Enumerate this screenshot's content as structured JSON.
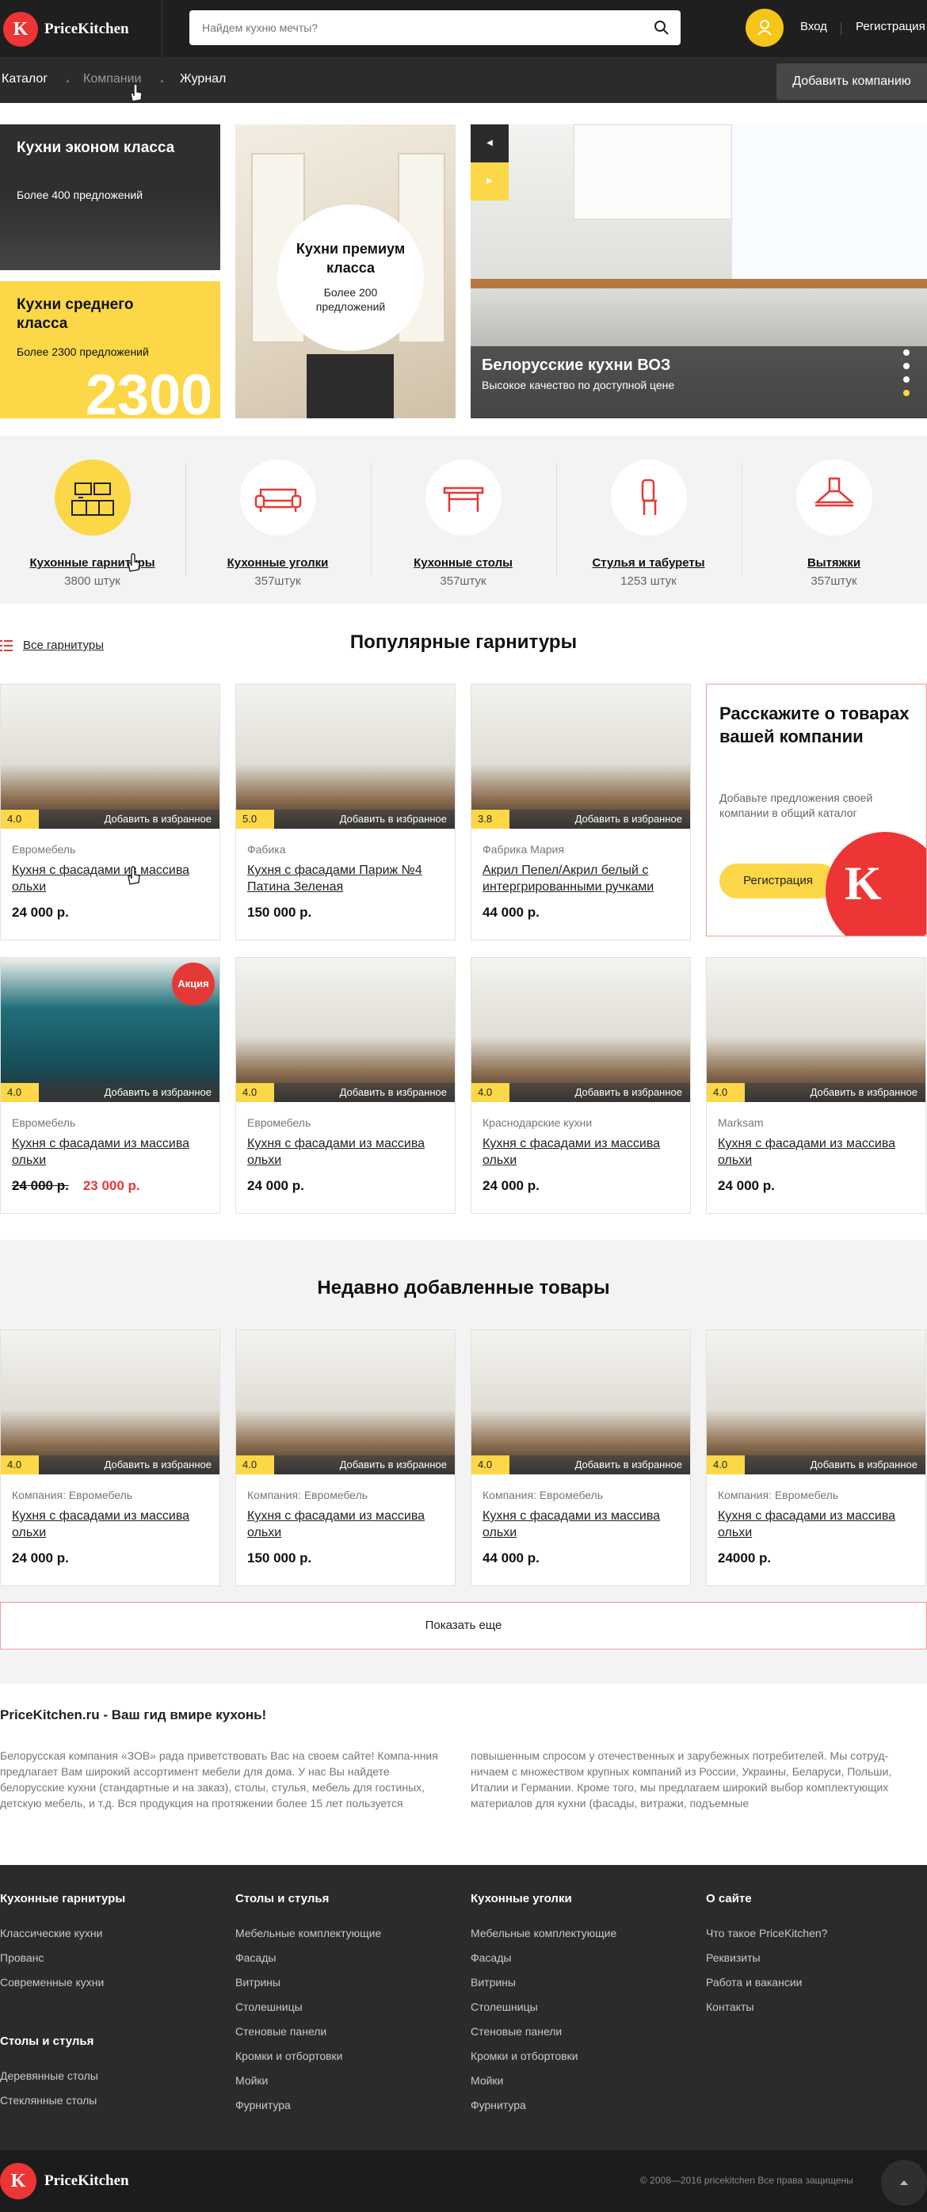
{
  "header": {
    "brand": "PriceKitchen",
    "logo_letter": "K",
    "search_placeholder": "Найдем кухню мечты?",
    "login": "Вход",
    "register": "Регистрация"
  },
  "nav": {
    "items": [
      "Каталог",
      "Компании",
      "Журнал"
    ],
    "add_company": "Добавить компанию"
  },
  "hero": {
    "econ": {
      "title": "Кухни эконом класса",
      "sub": "Более 400 предложений"
    },
    "mid": {
      "title": "Кухни среднего класса",
      "sub": "Более 2300 предложений",
      "big": "2300"
    },
    "premium": {
      "title": "Кухни премиум класса",
      "sub": "Более 200 предложений"
    },
    "slide": {
      "title": "Белорусские кухни ВОЗ",
      "sub": "Высокое качество по доступной цене"
    }
  },
  "categories": [
    {
      "label": "Кухонные гарнитуры",
      "count": "3800 штук",
      "icon": "kitchen-set-icon"
    },
    {
      "label": "Кухонные уголки",
      "count": "357штук",
      "icon": "sofa-icon"
    },
    {
      "label": "Кухонные столы",
      "count": "357штук",
      "icon": "table-icon"
    },
    {
      "label": "Стулья и табуреты",
      "count": "1253 штук",
      "icon": "chair-icon"
    },
    {
      "label": "Вытяжки",
      "count": "357штук",
      "icon": "hood-icon"
    }
  ],
  "popular": {
    "all_link": "Все гарнитуры",
    "title": "Популярные гарнитуры",
    "row1": [
      {
        "rating": "4.0",
        "fav": "Добавить в избранное",
        "brand": "Евромебель",
        "name": "Кухня с фасадами из массива ольхи",
        "price": "24 000 р."
      },
      {
        "rating": "5.0",
        "fav": "Добавить в избранное",
        "brand": "Фабика",
        "name": "Кухня с фасадами Париж №4 Патина Зеленая",
        "price": "150 000 р."
      },
      {
        "rating": "3.8",
        "fav": "Добавить в избранное",
        "brand": "Фабрика Мария",
        "name": "Акрил Пепел/Акрил белый с интергрированными ручками",
        "price": "44 000 р."
      }
    ],
    "promo": {
      "title": "Расскажите о товарах вашей компании",
      "text": "Добавьте предложения своей компании в общий каталог",
      "button": "Регистрация"
    },
    "row2": [
      {
        "rating": "4.0",
        "fav": "Добавить в избранное",
        "brand": "Евромебель",
        "name": "Кухня с фасадами из массива ольхи",
        "old_price": "24 000 р.",
        "price": "23 000 р.",
        "badge": "Акция"
      },
      {
        "rating": "4.0",
        "fav": "Добавить в избранное",
        "brand": "Евромебель",
        "name": "Кухня с фасадами из массива ольхи",
        "price": "24 000 р."
      },
      {
        "rating": "4.0",
        "fav": "Добавить в избранное",
        "brand": "Краснодарские кухни",
        "name": "Кухня с фасадами из массива ольхи",
        "price": "24 000 р."
      },
      {
        "rating": "4.0",
        "fav": "Добавить в избранное",
        "brand": "Marksam",
        "name": "Кухня с фасадами из массива ольхи",
        "price": "24 000 р."
      }
    ]
  },
  "recent": {
    "title": "Недавно добавленные товары",
    "items": [
      {
        "rating": "4.0",
        "fav": "Добавить в избранное",
        "brand": "Компания: Евромебель",
        "name": "Кухня с фасадами из массива ольхи",
        "price": "24 000 р."
      },
      {
        "rating": "4.0",
        "fav": "Добавить в избранное",
        "brand": "Компания: Евромебель",
        "name": "Кухня с фасадами из массива ольхи",
        "price": "150 000 р."
      },
      {
        "rating": "4.0",
        "fav": "Добавить в избранное",
        "brand": "Компания: Евромебель",
        "name": "Кухня с фасадами из массива ольхи",
        "price": "44 000 р."
      },
      {
        "rating": "4.0",
        "fav": "Добавить в избранное",
        "brand": "Компания: Евромебель",
        "name": "Кухня с фасадами из массива ольхи",
        "price": "24000 р."
      }
    ],
    "more": "Показать еще"
  },
  "about": {
    "title": "PriceKitchen.ru - Ваш гид вмире кухонь!",
    "left": "Белорусская компания «ЗОВ» рада приветствовать Вас на своем сайте! Компа-нния предлагает Вам широкий ассортимент мебели для дома. У нас Вы найдете белорусские кухни (стандартные и на заказ), столы, стулья, мебель для гостиных, детскую мебель, и т.д. Вся продукция на протяжении более 15 лет пользуется",
    "right": "повышенным спросом у отечественных и зарубежных потребителей. Мы сотруд-ничаем с множеством крупных компаний из России, Украины, Беларуси, Польши, Италии и Германии. Кроме того, мы предлагаем широкий выбор комплектующих материалов для кухни (фасады, витражи, подъемные"
  },
  "footer": {
    "col1": {
      "title": "Кухонные гарнитуры",
      "links": [
        "Классические кухни",
        "Прованс",
        "Современные кухни"
      ],
      "title2": "Столы и стулья",
      "links2": [
        "Деревянные столы",
        "Стеклянные столы"
      ]
    },
    "col2": {
      "title": "Столы и стулья",
      "links": [
        "Мебельные комплектующие",
        "Фасады",
        "Витрины",
        "Столешницы",
        "Стеновые панели",
        "Кромки и отбортовки",
        "Мойки",
        "Фурнитура"
      ]
    },
    "col3": {
      "title": "Кухонные уголки",
      "links": [
        "Мебельные комплектующие",
        "Фасады",
        "Витрины",
        "Столешницы",
        "Стеновые панели",
        "Кромки и отбортовки",
        "Мойки",
        "Фурнитура"
      ]
    },
    "col4": {
      "title": "О сайте",
      "links": [
        "Что такое PriceKitchen?",
        "Реквизиты",
        "Работа и вакансии",
        "Контакты"
      ]
    },
    "copyright": "© 2008—2016 pricekitchen Все права защищены"
  },
  "colors": {
    "accent_yellow": "#fcd748",
    "brand_red": "#ee3535",
    "dark": "#2b2b2b",
    "sale_red": "#e53935"
  }
}
